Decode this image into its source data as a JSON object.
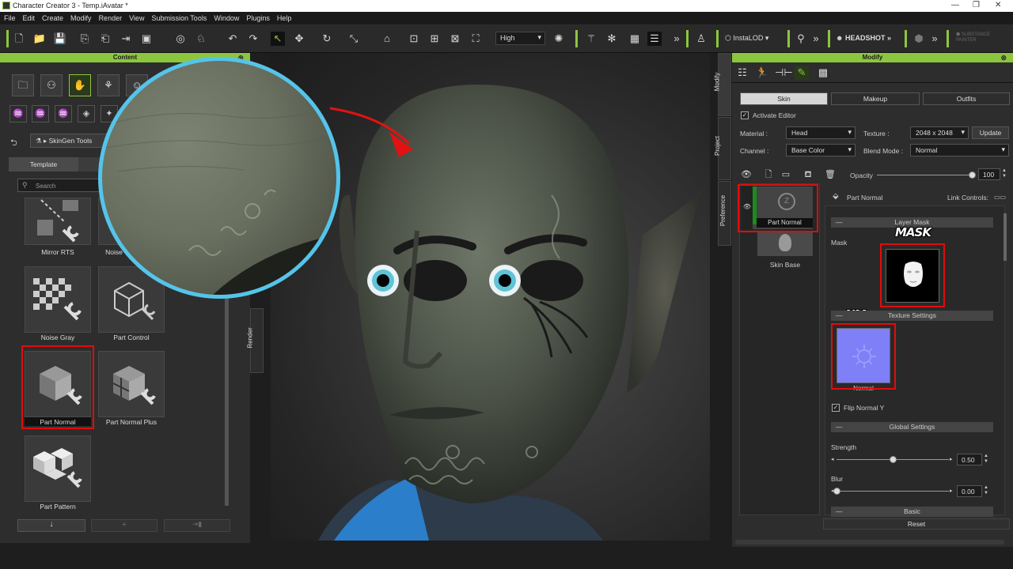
{
  "window": {
    "title": "Character Creator 3 - Temp.iAvatar *"
  },
  "menu": [
    "File",
    "Edit",
    "Create",
    "Modify",
    "Render",
    "View",
    "Submission Tools",
    "Window",
    "Plugins",
    "Help"
  ],
  "toolbar": {
    "quality": "High",
    "instalod": "InstaLOD",
    "headshot": "HEADSHOT",
    "substance": "SUBSTANCE PAINTER",
    "accent": "#8cc63f"
  },
  "content": {
    "title": "Content",
    "nav_label": "SkinGen Tools",
    "tab_template": "Template",
    "search_placeholder": "Search",
    "items": [
      "Mirror RTS",
      "Noise",
      "Noise Gray",
      "Part Control",
      "Part Normal",
      "Part Normal Plus",
      "Part Pattern"
    ]
  },
  "side_tabs": {
    "modify": "Modify",
    "project": "Project",
    "preference": "Preference",
    "render": "Render"
  },
  "modify": {
    "title": "Modify",
    "tabs": [
      "Skin",
      "Makeup",
      "Outfits"
    ],
    "activate_editor": "Activate Editor",
    "material_label": "Material :",
    "material_value": "Head",
    "texture_label": "Texture :",
    "texture_value": "2048 x 2048",
    "update": "Update",
    "channel_label": "Channel :",
    "channel_value": "Base Color",
    "blend_label": "Blend Mode :",
    "blend_value": "Normal",
    "opacity_label": "Opacity",
    "opacity_value": "100",
    "opacity_fraction": 1.0,
    "layers": [
      "Part Normal",
      "Skin Base"
    ],
    "detail_title": "Part Normal",
    "link_controls": "Link Controls:",
    "layer_mask": "Layer Mask",
    "mask_label": "Mask",
    "mask_annot": "MASK",
    "nm_annot": "NM",
    "texture_settings": "Texture Settings",
    "normal_label": "Normal",
    "flip_normal": "Flip Normal Y",
    "global_settings": "Global Settings",
    "strength_label": "Strength",
    "strength_value": "0.50",
    "strength_fraction": 0.5,
    "blur_label": "Blur",
    "blur_value": "0.00",
    "blur_fraction": 0.0,
    "basic": "Basic",
    "reset": "Reset"
  }
}
